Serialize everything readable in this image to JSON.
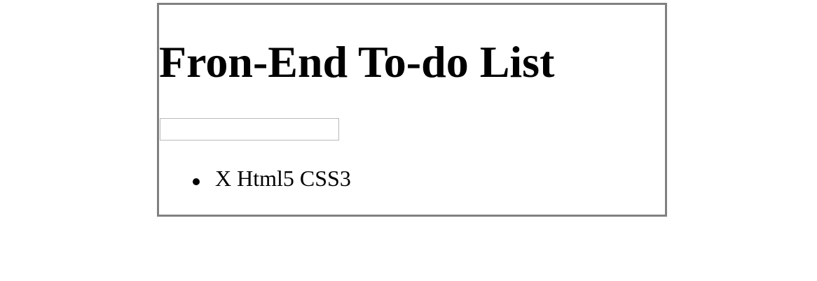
{
  "app": {
    "title": "Fron-End To-do List"
  },
  "input": {
    "value": "",
    "placeholder": ""
  },
  "todos": [
    {
      "delete_label": "X",
      "text": "Html5 CSS3"
    }
  ],
  "colors": {
    "border": "#808080",
    "input_border": "#b9b9b9",
    "text": "#000000",
    "background": "#ffffff"
  }
}
